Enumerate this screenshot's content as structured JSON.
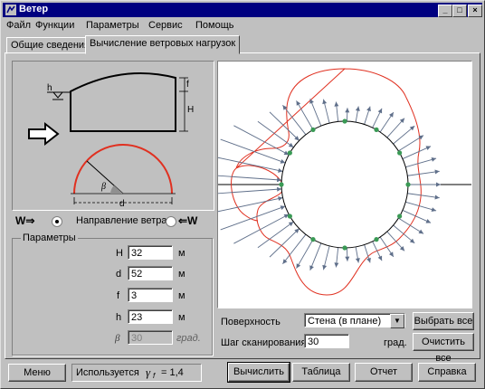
{
  "window": {
    "title": "Ветер"
  },
  "menu": [
    "Файл",
    "Функции",
    "Параметры",
    "Сервис",
    "Помощь"
  ],
  "tabs": [
    "Общие сведения",
    "Вычисление ветровых нагрузок"
  ],
  "diagram": {
    "h_label": "h",
    "f_label": "f",
    "H_label": "H",
    "beta_label": "β",
    "d_label": "d"
  },
  "direction": {
    "left_label": "W⇒",
    "text": "Направление ветра",
    "right_label": "⇐W"
  },
  "params": {
    "group_title": "Параметры",
    "rows": [
      {
        "name": "H",
        "value": "32",
        "unit": "м"
      },
      {
        "name": "d",
        "value": "52",
        "unit": "м"
      },
      {
        "name": "f",
        "value": "3",
        "unit": "м"
      },
      {
        "name": "h",
        "value": "23",
        "unit": "м"
      },
      {
        "name": "β",
        "value": "30",
        "unit": "град."
      }
    ]
  },
  "controls": {
    "surface_label": "Поверхность",
    "surface_value": "Стена (в плане)",
    "step_label": "Шаг сканирования",
    "step_value": "30",
    "step_unit": "град.",
    "select_all": "Выбрать все",
    "clear_all": "Очистить все"
  },
  "bottom": {
    "menu": "Меню",
    "uses_prefix": "Используется",
    "gamma_symbol": "γ",
    "gamma_sub": "f",
    "gamma_value": "= 1,4",
    "compute": "Вычислить",
    "table": "Таблица",
    "report": "Отчет",
    "help": "Справка"
  },
  "colors": {
    "titlebar": "#000080",
    "outline_red": "#e03020",
    "arrow": "#5f6f8a",
    "node": "#3a9a55"
  }
}
